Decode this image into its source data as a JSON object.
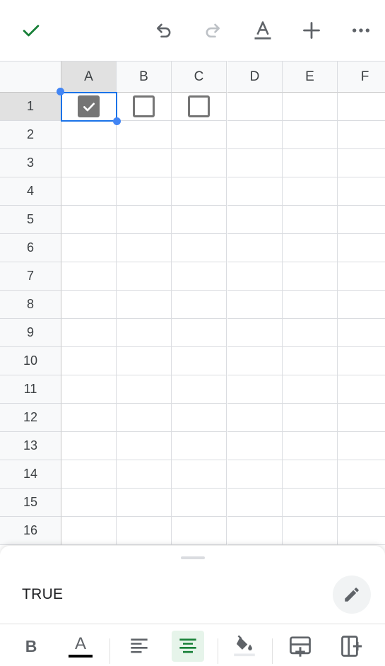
{
  "toolbar": {
    "confirm_icon": "checkmark-icon",
    "undo_icon": "undo-icon",
    "redo_icon": "redo-icon",
    "text_format_icon": "text-format-icon",
    "insert_icon": "plus-icon",
    "more_icon": "more-options-icon"
  },
  "grid": {
    "columns": [
      "A",
      "B",
      "C",
      "D",
      "E",
      "F"
    ],
    "rows": [
      "1",
      "2",
      "3",
      "4",
      "5",
      "6",
      "7",
      "8",
      "9",
      "10",
      "11",
      "12",
      "13",
      "14",
      "15",
      "16"
    ],
    "selected_cell": "A1",
    "checkboxes": [
      {
        "cell": "A1",
        "checked": true
      },
      {
        "cell": "B1",
        "checked": false
      },
      {
        "cell": "C1",
        "checked": false
      }
    ]
  },
  "bottom_sheet": {
    "cell_value": "TRUE",
    "edit_icon": "pencil-icon",
    "format": {
      "bold_label": "B",
      "text_color_label": "A",
      "align_left_icon": "align-left-icon",
      "align_center_icon": "align-center-icon",
      "fill_color_icon": "fill-color-icon",
      "insert_row_icon": "insert-row-icon",
      "insert_column_icon": "insert-column-icon",
      "active_alignment": "center"
    }
  },
  "colors": {
    "accent_green": "#188038",
    "selection_blue": "#1a73e8",
    "checkbox_gray": "#757575"
  }
}
